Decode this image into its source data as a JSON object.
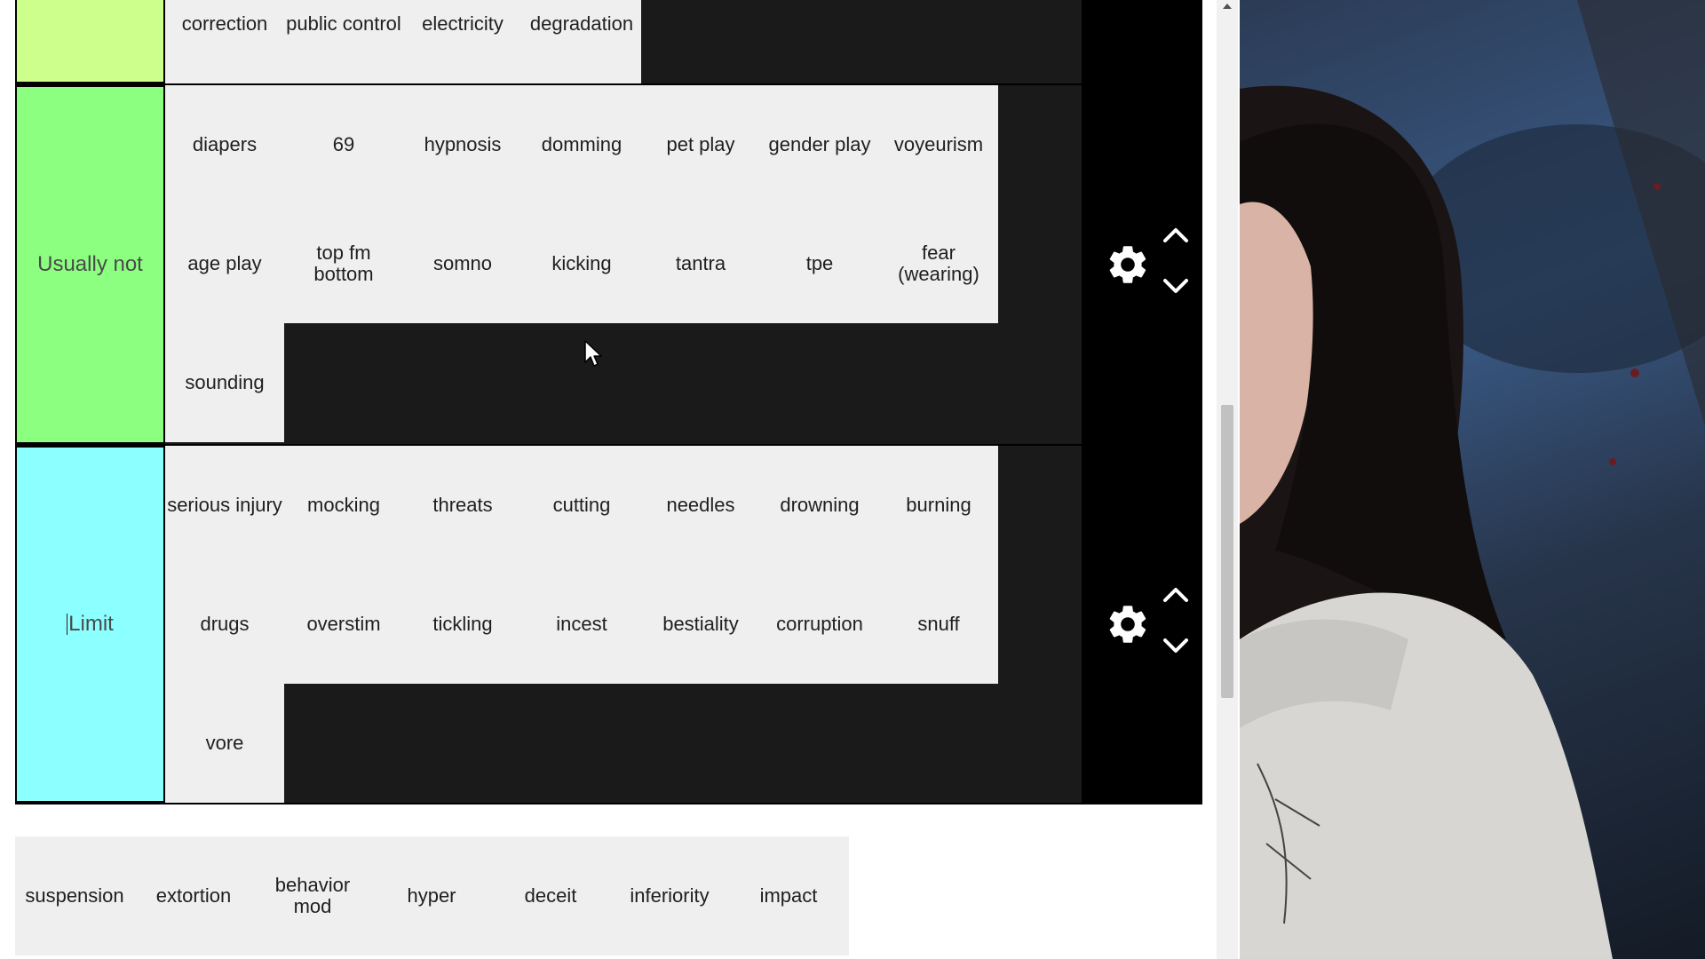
{
  "tiers": [
    {
      "label": "",
      "color": "#ccff8c",
      "items": [
        "correction",
        "public control",
        "electricity",
        "degradation"
      ]
    },
    {
      "label": "Usually not",
      "color": "#8cff80",
      "items": [
        "diapers",
        "69",
        "hypnosis",
        "domming",
        "pet play",
        "gender play",
        "voyeurism",
        "age play",
        "top fm bottom",
        "somno",
        "kicking",
        "tantra",
        "tpe",
        "fear (wearing)",
        "sounding"
      ]
    },
    {
      "label": "Limit",
      "color": "#8cffff",
      "items": [
        "serious injury",
        "mocking",
        "threats",
        "cutting",
        "needles",
        "drowning",
        "burning",
        "drugs",
        "overstim",
        "tickling",
        "incest",
        "bestiality",
        "corruption",
        "snuff",
        "vore"
      ]
    }
  ],
  "pool": {
    "items": [
      "suspension",
      "extortion",
      "behavior mod",
      "hyper",
      "deceit",
      "inferiority",
      "impact"
    ]
  },
  "controls": {
    "settings_icon": "gear-icon",
    "move_up_icon": "chevron-up-icon",
    "move_down_icon": "chevron-down-icon"
  },
  "colors": {
    "tier_background": "#1a1a1a",
    "item_background": "#efefef",
    "controls_background": "#000000"
  }
}
